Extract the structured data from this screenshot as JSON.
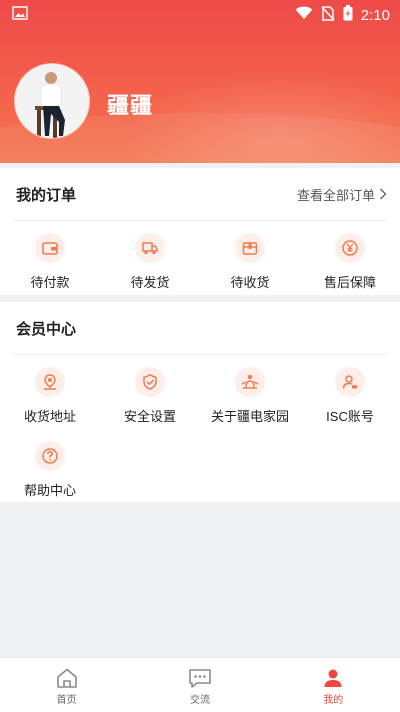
{
  "status_bar": {
    "time": "2:10"
  },
  "profile": {
    "username": "疆疆"
  },
  "orders": {
    "title": "我的订单",
    "view_all": "查看全部订单",
    "items": [
      {
        "label": "待付款",
        "icon": "wallet-icon"
      },
      {
        "label": "待发货",
        "icon": "truck-icon"
      },
      {
        "label": "待收货",
        "icon": "package-icon"
      },
      {
        "label": "售后保障",
        "icon": "yuan-icon"
      }
    ]
  },
  "member": {
    "title": "会员中心",
    "items": [
      {
        "label": "收货地址",
        "icon": "location-pin-icon"
      },
      {
        "label": "安全设置",
        "icon": "shield-check-icon"
      },
      {
        "label": "关于疆电家园",
        "icon": "info-people-icon"
      },
      {
        "label": "ISC账号",
        "icon": "user-account-icon"
      },
      {
        "label": "帮助中心",
        "icon": "question-icon"
      }
    ]
  },
  "tabs": [
    {
      "label": "首页",
      "icon": "home-icon"
    },
    {
      "label": "交流",
      "icon": "chat-icon"
    },
    {
      "label": "我的",
      "icon": "user-icon"
    }
  ],
  "colors": {
    "accent": "#f0473c",
    "icon_tint": "#f47a4e",
    "icon_bg": "#fdeeea"
  }
}
